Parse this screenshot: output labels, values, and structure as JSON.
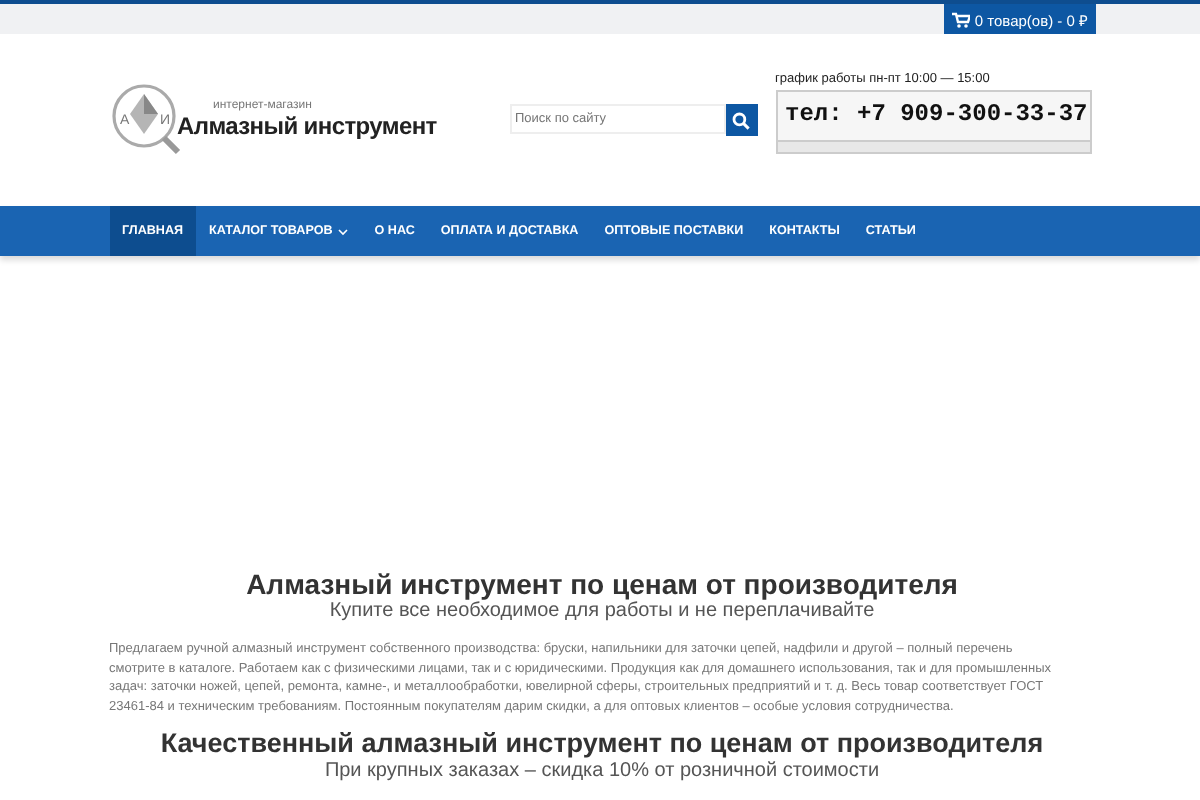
{
  "cart": {
    "label": "0 товар(ов) - 0 ₽"
  },
  "logo": {
    "letters": [
      "А",
      "И"
    ],
    "tagline": "интернет-магазин",
    "name": "Алмазный инструмент"
  },
  "search": {
    "placeholder": "Поиск по сайту"
  },
  "contacts": {
    "hours": "график работы  пн-пт 10:00 — 15:00",
    "phone": "тел: +7 909-300-33-37"
  },
  "nav": [
    {
      "label": "ГЛАВНАЯ",
      "selected": true,
      "dropdown": false
    },
    {
      "label": "КАТАЛОГ ТОВАРОВ",
      "selected": false,
      "dropdown": true
    },
    {
      "label": "О НАС",
      "selected": false,
      "dropdown": false
    },
    {
      "label": "ОПЛАТА И ДОСТАВКА",
      "selected": false,
      "dropdown": false
    },
    {
      "label": "ОПТОВЫЕ ПОСТАВКИ",
      "selected": false,
      "dropdown": false
    },
    {
      "label": "КОНТАКТЫ",
      "selected": false,
      "dropdown": false
    },
    {
      "label": "СТАТЬИ",
      "selected": false,
      "dropdown": false
    }
  ],
  "content": {
    "title": "Алмазный инструмент по ценам от производителя",
    "subtitle": "Купите все необходимое для работы и не переплачивайте",
    "paragraph": "Предлагаем ручной алмазный инструмент собственного производства: бруски, напильники для заточки цепей, надфили и другой – полный перечень смотрите в каталоге. Работаем как с физическими лицами, так и с юридическими. Продукция как для домашнего использования, так и для промышленных задач: заточки ножей, цепей, ремонта, камне-, и металлообработки, ювелирной сферы, строительных предприятий и т. д. Весь товар соответствует ГОСТ 23461-84 и техническим требованиям. Постоянным покупателям дарим скидки, а для оптовых клиентов – особые условия сотрудничества.",
    "title2": "Качественный алмазный инструмент по ценам от производителя",
    "subtitle2": "При крупных заказах – скидка 10% от розничной стоимости"
  }
}
